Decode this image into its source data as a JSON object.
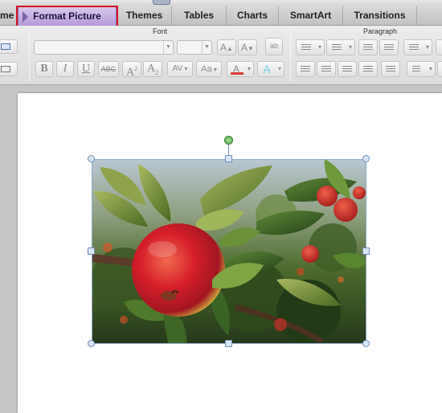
{
  "tabs": [
    {
      "label": "me",
      "active": false
    },
    {
      "label": "Format Picture",
      "active": true
    },
    {
      "label": "Themes",
      "active": false
    },
    {
      "label": "Tables",
      "active": false
    },
    {
      "label": "Charts",
      "active": false
    },
    {
      "label": "SmartArt",
      "active": false
    },
    {
      "label": "Transitions",
      "active": false
    }
  ],
  "ribbon": {
    "font_group_title": "Font",
    "paragraph_group_title": "Paragraph",
    "font_buttons": {
      "bold": "B",
      "italic": "I",
      "underline": "U",
      "strike": "ABC",
      "superscript": "A",
      "superscript_mark": "2",
      "subscript": "A",
      "subscript_mark": "2",
      "spacing": "AV",
      "case": "Aa",
      "font_color": "A",
      "text_effects": "A",
      "grow": "A",
      "shrink": "A",
      "clear": "ab"
    }
  },
  "colors": {
    "active_tab": "#b49ad8",
    "highlight_box": "#d4151d",
    "font_color_bar": "#d93b3b",
    "text_effects": "#6fc8e8",
    "rotation_handle": "#4aa43e",
    "selection_handle": "#6f8db5"
  },
  "picture": {
    "subject": "red apple on tree branch with leaves"
  }
}
